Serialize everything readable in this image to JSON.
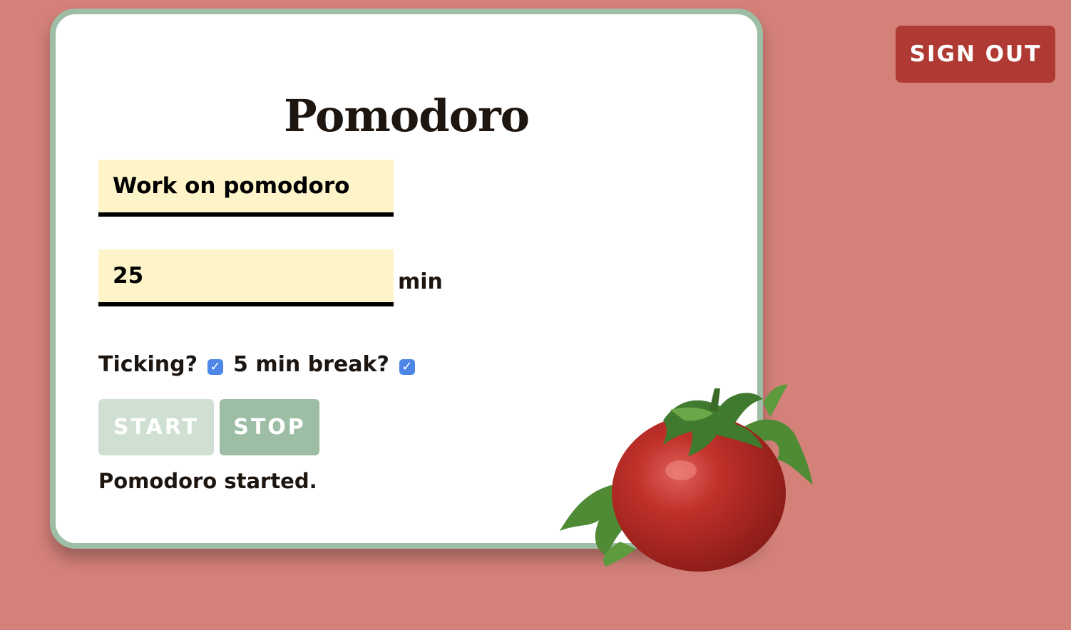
{
  "header": {
    "sign_out_label": "SIGN OUT"
  },
  "card": {
    "title": "Pomodoro",
    "task_input_value": "Work on pomodoro",
    "minutes_input_value": "25",
    "minutes_unit": "min",
    "ticking_label": "Ticking?",
    "ticking_checked": true,
    "break_label": "5 min break?",
    "break_checked": true,
    "start_label": "START",
    "stop_label": "STOP",
    "status_text": "Pomodoro started."
  },
  "colors": {
    "background": "#d4817a",
    "card_border": "#9dbda5",
    "input_fill": "#fdf5c9",
    "sign_out": "#af3a33",
    "checkbox": "#4d86e6"
  },
  "icons": {
    "tomato": "tomato-illustration",
    "check": "check-icon"
  }
}
